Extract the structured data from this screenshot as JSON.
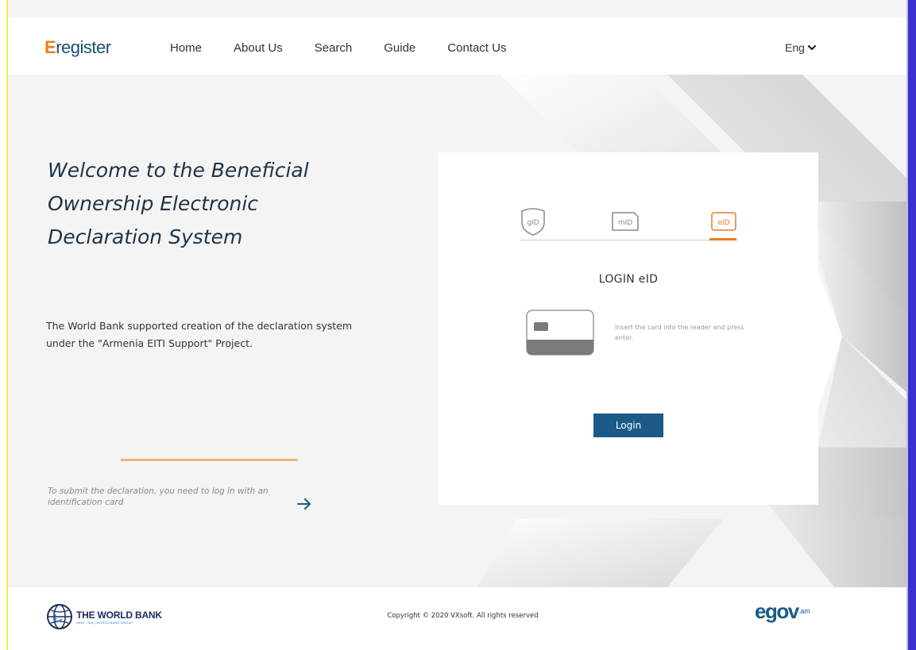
{
  "header": {
    "logo": {
      "initial": "E",
      "rest": "register"
    },
    "nav": [
      "Home",
      "About Us",
      "Search",
      "Guide",
      "Contact Us"
    ],
    "language": "Eng"
  },
  "hero": {
    "welcome": "Welcome to the Beneficial Ownership Electronic Declaration System",
    "support": "The World Bank supported creation of the declaration system under the \"Armenia EITI Support\" Project.",
    "submit_note": "To submit the declaration, you need to log in with an identification card"
  },
  "login": {
    "tabs": [
      "gID",
      "mID",
      "eID"
    ],
    "active_tab": "eID",
    "title": "LOGIN eID",
    "instruction": "Insert the card into the reader and press enter.",
    "button": "Login"
  },
  "footer": {
    "worldbank_name": "THE WORLD BANK",
    "worldbank_sub": "IBRD · IDA | WORLD BANK GROUP",
    "copyright": "Copyright © 2020 VXsoft. All rights reserved",
    "egov": "egov",
    "egov_suffix": ".am"
  },
  "icons": [
    "chevron-down-icon",
    "arrow-right-icon",
    "gid-shield-icon",
    "mid-sim-icon",
    "eid-card-icon",
    "id-card-reader-icon",
    "globe-icon"
  ],
  "colors": {
    "accent": "#ef7a1a",
    "primary": "#1b5a86",
    "heading": "#1f3346"
  }
}
